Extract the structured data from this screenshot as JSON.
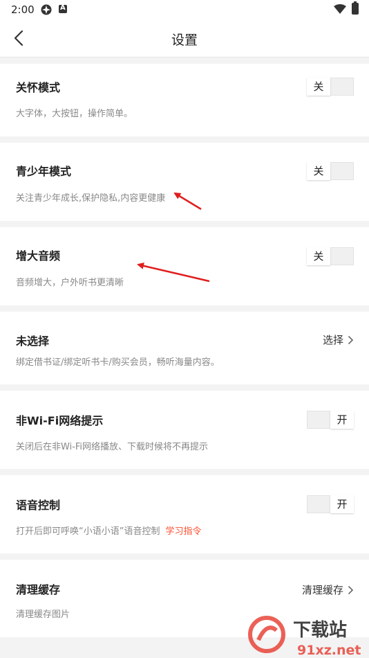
{
  "status_bar": {
    "time": "2:00"
  },
  "header": {
    "title": "设置"
  },
  "settings": [
    {
      "title": "关怀模式",
      "desc": "大字体，大按钮，操作简单。",
      "toggle": {
        "state": "off",
        "label": "关"
      }
    },
    {
      "title": "青少年模式",
      "desc": "关注青少年成长,保护隐私,内容更健康",
      "toggle": {
        "state": "off",
        "label": "关"
      }
    },
    {
      "title": "增大音频",
      "desc": "音频增大，户外听书更清晰",
      "toggle": {
        "state": "off",
        "label": "关"
      }
    },
    {
      "title": "未选择",
      "desc": "绑定借书证/绑定听书卡/购买会员，畅听海量内容。",
      "action": "选择"
    },
    {
      "title": "非Wi-Fi网络提示",
      "desc": "关闭后在非Wi-Fi网络播放、下载时候将不再提示",
      "toggle": {
        "state": "on",
        "label": "开"
      }
    },
    {
      "title": "语音控制",
      "desc": "打开后即可呼唤“小语小语”语音控制",
      "link": "学习指令",
      "toggle": {
        "state": "on",
        "label": "开"
      }
    },
    {
      "title": "清理缓存",
      "desc": "清理缓存图片",
      "action": "清理缓存"
    }
  ],
  "watermark": {
    "text": "下载站",
    "url_text": "91xz.net"
  },
  "colors": {
    "accent": "#ff4d2e",
    "arrow": "#e01e1e"
  }
}
